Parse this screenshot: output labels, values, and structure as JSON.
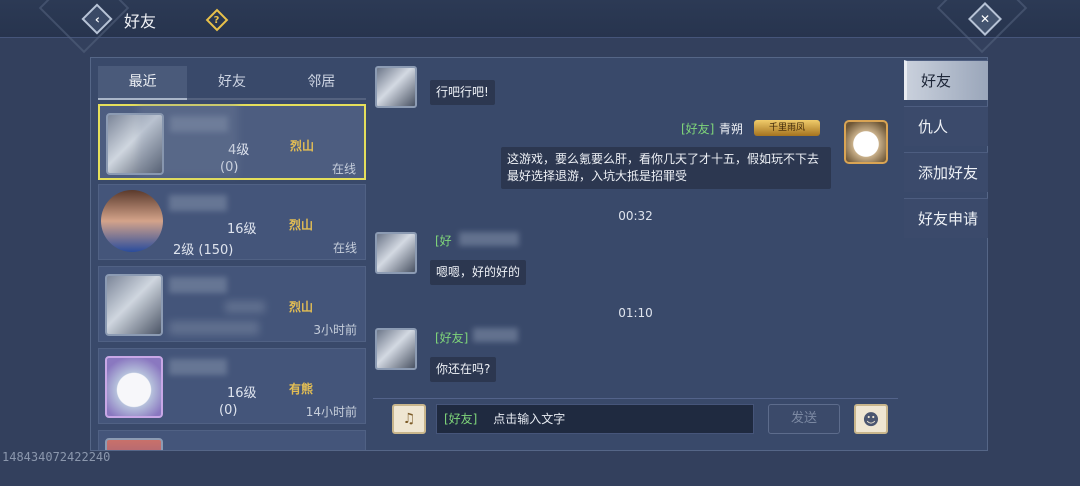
{
  "header": {
    "title": "好友",
    "back_icon": "chevron-left-icon",
    "help_icon": "question-icon",
    "close_icon": "close-icon"
  },
  "tabs": [
    {
      "label": "最近",
      "active": true
    },
    {
      "label": "好友",
      "active": false
    },
    {
      "label": "邻居",
      "active": false
    }
  ],
  "friends": [
    {
      "level": "4级",
      "school": "烈山",
      "sub": "(0)",
      "status": "在线",
      "selected": true
    },
    {
      "level": "16级",
      "school": "烈山",
      "sub": "2级 (150)",
      "status": "在线",
      "selected": false
    },
    {
      "level": "",
      "school": "烈山",
      "sub": "",
      "status": "3小时前",
      "selected": false
    },
    {
      "level": "16级",
      "school": "有熊",
      "sub": "(0)",
      "status": "14小时前",
      "selected": false
    }
  ],
  "chat": {
    "messages": [
      {
        "text": "行吧行吧!"
      },
      {
        "tag": "[好友]",
        "name": "青朔",
        "badge": "千里雨凤",
        "text": "这游戏，要么氪要么肝，看你几天了才十五，假如玩不下去最好选择退游，入坑大抵是招罪受"
      },
      {
        "time": "00:32"
      },
      {
        "tag": "[好",
        "text": "嗯嗯，好的好的"
      },
      {
        "time": "01:10"
      },
      {
        "tag": "[好友]",
        "text": "你还在吗?"
      }
    ],
    "input": {
      "tag": "[好友]",
      "placeholder": "点击输入文字"
    },
    "send_label": "发送"
  },
  "side_tabs": [
    {
      "label": "好友",
      "active": true
    },
    {
      "label": "仇人",
      "active": false
    },
    {
      "label": "添加好友",
      "active": false
    },
    {
      "label": "好友申请",
      "active": false
    }
  ],
  "watermark": "148434072422240"
}
